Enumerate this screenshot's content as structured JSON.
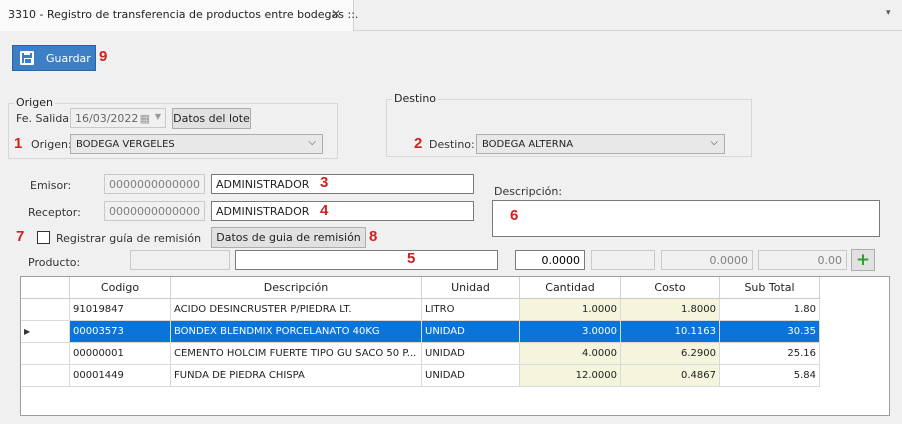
{
  "tab": {
    "title": "3310 - Registro de transferencia de productos entre bodegas ::.",
    "close": "✕",
    "menu": "▾"
  },
  "toolbar": {
    "save_label": "Guardar"
  },
  "markers": [
    "1",
    "2",
    "3",
    "4",
    "5",
    "6",
    "7",
    "8",
    "9"
  ],
  "origen": {
    "title": "Origen",
    "fe_salida_label": "Fe. Salida:",
    "fe_salida_value": "16/03/2022",
    "datos_lote_label": "Datos del lote",
    "origen_label": "Origen:",
    "origen_value": "BODEGA VERGELES"
  },
  "destino": {
    "title": "Destino",
    "destino_label": "Destino:",
    "destino_value": "BODEGA ALTERNA"
  },
  "emisor": {
    "label": "Emisor:",
    "code": "0000000000000",
    "name": "ADMINISTRADOR"
  },
  "receptor": {
    "label": "Receptor:",
    "code": "0000000000000",
    "name": "ADMINISTRADOR"
  },
  "descripcion": {
    "label": "Descripción:",
    "value": ""
  },
  "guia": {
    "checkbox_label": "Registrar guía de remisión",
    "checked": false,
    "button_label": "Datos de guia de remisión"
  },
  "producto": {
    "label": "Producto:",
    "code": "",
    "name": "",
    "cantidad": "0.0000",
    "field4": "",
    "costo": "0.0000",
    "subtotal": "0.00"
  },
  "grid": {
    "headers": [
      "Codigo",
      "Descripción",
      "Unidad",
      "Cantidad",
      "Costo",
      "Sub Total"
    ],
    "rows": [
      [
        "91019847",
        "ACIDO DESINCRUSTER P/PIEDRA LT.",
        "LITRO",
        "1.0000",
        "1.8000",
        "1.80"
      ],
      [
        "00003573",
        "BONDEX BLENDMIX PORCELANATO 40KG",
        "UNIDAD",
        "3.0000",
        "10.1163",
        "30.35"
      ],
      [
        "00000001",
        "CEMENTO HOLCIM FUERTE TIPO GU SACO 50 P...",
        "UNIDAD",
        "4.0000",
        "6.2900",
        "25.16"
      ],
      [
        "00001449",
        "FUNDA DE PIEDRA CHISPA",
        "UNIDAD",
        "12.0000",
        "0.4867",
        "5.84"
      ]
    ],
    "selected_row": 1
  },
  "colors": {
    "accent": "#3d7fc4",
    "selection": "#0a74d9",
    "marker": "#d21f1f",
    "qty_bg": "#f5f4dc"
  }
}
